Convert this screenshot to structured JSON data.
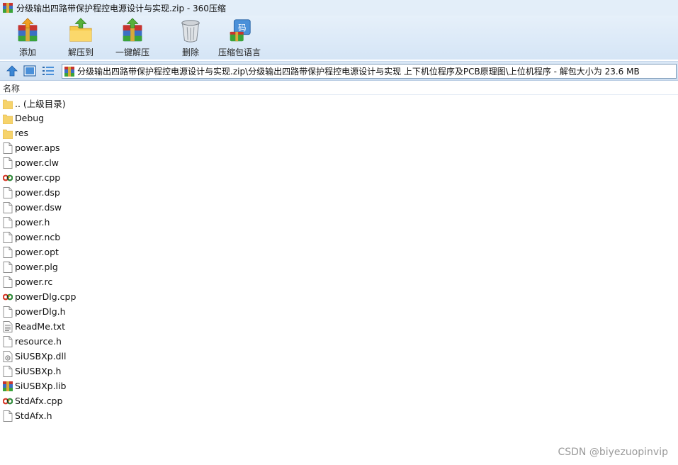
{
  "window": {
    "title": "分级输出四路带保护程控电源设计与实现.zip - 360压缩"
  },
  "toolbar": {
    "buttons": [
      {
        "label": "添加",
        "icon": "add-archive-icon"
      },
      {
        "label": "解压到",
        "icon": "extract-to-folder-icon"
      },
      {
        "label": "一键解压",
        "icon": "one-click-extract-icon"
      },
      {
        "label": "删除",
        "icon": "trash-can-icon"
      },
      {
        "label": "压缩包语言",
        "icon": "archive-language-icon"
      }
    ]
  },
  "navigation": {
    "icons": [
      "up-arrow-icon",
      "large-icons-view-icon",
      "list-view-icon"
    ],
    "address": "分级输出四路带保护程控电源设计与实现.zip\\分级输出四路带保护程控电源设计与实现 上下机位程序及PCB原理图\\上位机程序 - 解包大小为 23.6 MB"
  },
  "list": {
    "column_header": "名称",
    "files": [
      {
        "name": ".. (上级目录)",
        "type": "folder"
      },
      {
        "name": "Debug",
        "type": "folder"
      },
      {
        "name": "res",
        "type": "folder"
      },
      {
        "name": "power.aps",
        "type": "file"
      },
      {
        "name": "power.clw",
        "type": "file"
      },
      {
        "name": "power.cpp",
        "type": "cpp"
      },
      {
        "name": "power.dsp",
        "type": "file"
      },
      {
        "name": "power.dsw",
        "type": "file"
      },
      {
        "name": "power.h",
        "type": "file"
      },
      {
        "name": "power.ncb",
        "type": "file"
      },
      {
        "name": "power.opt",
        "type": "file"
      },
      {
        "name": "power.plg",
        "type": "file"
      },
      {
        "name": "power.rc",
        "type": "file"
      },
      {
        "name": "powerDlg.cpp",
        "type": "cpp"
      },
      {
        "name": "powerDlg.h",
        "type": "file"
      },
      {
        "name": "ReadMe.txt",
        "type": "text"
      },
      {
        "name": "resource.h",
        "type": "file"
      },
      {
        "name": "SiUSBXp.dll",
        "type": "dll"
      },
      {
        "name": "SiUSBXp.h",
        "type": "file"
      },
      {
        "name": "SiUSBXp.lib",
        "type": "lib"
      },
      {
        "name": "StdAfx.cpp",
        "type": "cpp"
      },
      {
        "name": "StdAfx.h",
        "type": "file"
      }
    ]
  },
  "watermark": "CSDN @biyezuopinvip",
  "colors": {
    "titlebar": "#e3eef9",
    "toolbar": "#d5e5f6",
    "folder": "#f6d36b",
    "accent": "#3a86d4"
  }
}
